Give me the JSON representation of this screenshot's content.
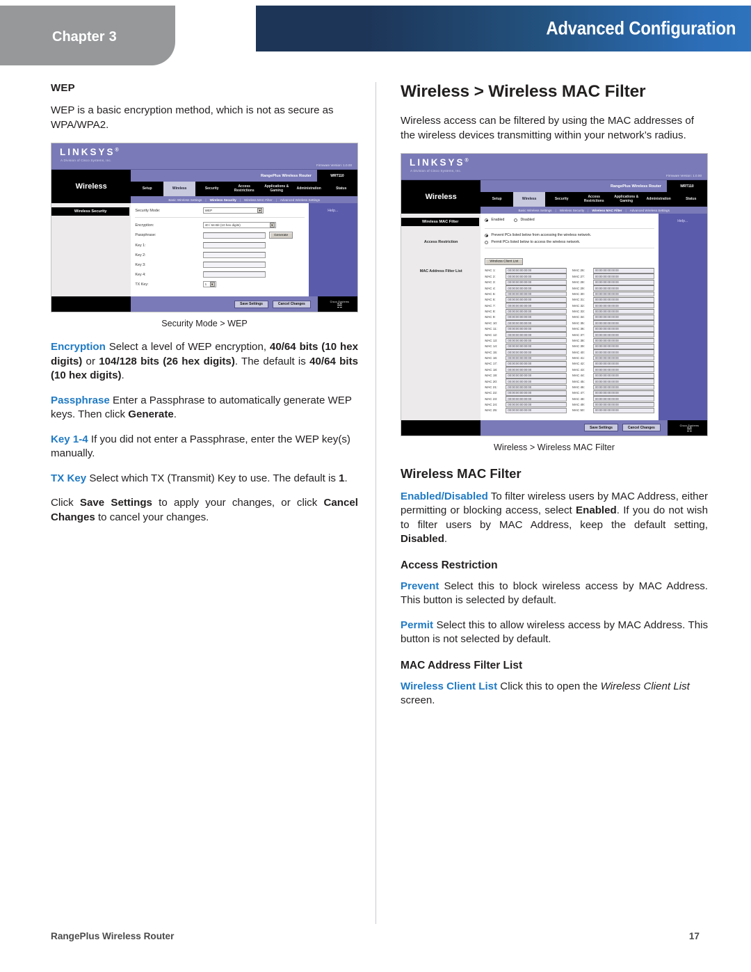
{
  "header": {
    "chapter_label": "Chapter",
    "chapter_number": "3",
    "title": "Advanced Configuration",
    "navy": "#1d3557",
    "blue": "#2b6cb5",
    "gray": "#96989a"
  },
  "accent_color": "#1f7ac4",
  "left_column": {
    "section_heading": "WEP",
    "intro": "WEP is a basic encryption method, which is not as secure as WPA/WPA2.",
    "figure_caption": "Security Mode > WEP",
    "paragraphs": [
      {
        "term": "Encryption",
        "text_parts": [
          {
            "t": " Select a level of WEP encryption, ",
            "style": "normal"
          },
          {
            "t": "40/64 bits (10 hex digits)",
            "style": "bold"
          },
          {
            "t": " or ",
            "style": "normal"
          },
          {
            "t": "104/128 bits (26 hex digits)",
            "style": "bold"
          },
          {
            "t": ". The default is ",
            "style": "normal"
          },
          {
            "t": "40/64 bits (10 hex digits)",
            "style": "bold"
          },
          {
            "t": ".",
            "style": "normal"
          }
        ]
      },
      {
        "term": "Passphrase",
        "text_parts": [
          {
            "t": "  Enter a Passphrase to automatically generate WEP keys. Then click ",
            "style": "normal"
          },
          {
            "t": "Generate",
            "style": "bold"
          },
          {
            "t": ".",
            "style": "normal"
          }
        ]
      },
      {
        "term": "Key 1-4",
        "text_parts": [
          {
            "t": "  If you did not enter a Passphrase, enter the WEP key(s) manually.",
            "style": "normal"
          }
        ]
      },
      {
        "term": "TX Key",
        "text_parts": [
          {
            "t": "  Select which TX (Transmit) Key to use. The default is ",
            "style": "normal"
          },
          {
            "t": "1",
            "style": "bold"
          },
          {
            "t": ".",
            "style": "normal"
          }
        ]
      }
    ],
    "closing_parts": [
      {
        "t": "Click ",
        "style": "normal"
      },
      {
        "t": "Save Settings",
        "style": "bold"
      },
      {
        "t": " to apply your changes, or click ",
        "style": "normal"
      },
      {
        "t": "Cancel Changes",
        "style": "bold"
      },
      {
        "t": " to cancel your changes.",
        "style": "normal"
      }
    ]
  },
  "right_column": {
    "page_heading": "Wireless > Wireless MAC Filter",
    "intro": "Wireless access can be filtered by using the MAC addresses of the wireless devices transmitting within your network’s radius.",
    "figure_caption": "Wireless > Wireless MAC Filter",
    "sub_heading": "Wireless MAC Filter",
    "enabled_disabled": {
      "term": "Enabled/Disabled",
      "parts": [
        {
          "t": "  To filter wireless users by MAC Address, either permitting or blocking access, select ",
          "style": "normal"
        },
        {
          "t": "Enabled",
          "style": "bold"
        },
        {
          "t": ". If you do not wish to filter users by MAC Address, keep the default setting, ",
          "style": "normal"
        },
        {
          "t": "Disabled",
          "style": "bold"
        },
        {
          "t": ".",
          "style": "normal"
        }
      ]
    },
    "access_restriction_heading": "Access Restriction",
    "prevent": {
      "term": "Prevent",
      "parts": [
        {
          "t": " Select this to block wireless access by MAC Address. This button is selected by default.",
          "style": "normal"
        }
      ]
    },
    "permit": {
      "term": "Permit",
      "parts": [
        {
          "t": " Select this to allow wireless access by MAC Address. This button is not selected by default.",
          "style": "normal"
        }
      ]
    },
    "mac_list_heading": "MAC Address Filter List",
    "wireless_client_list": {
      "term": "Wireless Client List",
      "parts": [
        {
          "t": "  Click this to open the ",
          "style": "normal"
        },
        {
          "t": "Wireless Client List",
          "style": "italic"
        },
        {
          "t": " screen.",
          "style": "normal"
        }
      ]
    }
  },
  "router_ui": {
    "brand": "LINKSYS",
    "brand_tm": "®",
    "brand_sub": "A Division of Cisco Systems, Inc.",
    "firmware": "Firmware Version: 1.0.00",
    "model_name": "RangePlus Wireless Router",
    "model_number": "WRT110",
    "section_name": "Wireless",
    "tabs": [
      "Setup",
      "Wireless",
      "Security",
      "Access Restrictions",
      "Applications & Gaming",
      "Administration",
      "Status"
    ],
    "active_tab": "Wireless",
    "subtabs": [
      "Basic Wireless Settings",
      "Wireless Security",
      "Wireless MAC Filter",
      "Advanced Wireless Settings"
    ],
    "help_label": "Help...",
    "save_label": "Save Settings",
    "cancel_label": "Cancel Changes",
    "footer_brand_top": "Cisco Systems",
    "footer_brand_mark": "☵"
  },
  "wep_screen": {
    "panel_title": "Wireless Security",
    "active_subtab": "Wireless Security",
    "fields": [
      {
        "label": "Security Mode:",
        "type": "select",
        "value": "WEP"
      },
      {
        "label": "Encryption:",
        "type": "select",
        "value": "40 / 64-Bit (10 hex digits)"
      },
      {
        "label": "Passphrase:",
        "type": "input",
        "value": "",
        "button": "Generate"
      },
      {
        "label": "Key 1:",
        "type": "input",
        "value": ""
      },
      {
        "label": "Key 2:",
        "type": "input",
        "value": ""
      },
      {
        "label": "Key 3:",
        "type": "input",
        "value": ""
      },
      {
        "label": "Key 4:",
        "type": "input",
        "value": ""
      },
      {
        "label": "TX Key:",
        "type": "smallselect",
        "value": "1"
      }
    ]
  },
  "mac_screen": {
    "panel_title": "Wireless MAC Filter",
    "active_subtab": "Wireless MAC Filter",
    "side_label": "Access Restriction",
    "mac_list_label": "MAC Address Filter List",
    "enable_options": [
      {
        "label": "Enabled",
        "selected": true
      },
      {
        "label": "Disabled",
        "selected": false
      }
    ],
    "restriction_options": [
      {
        "label": "Prevent  PCs listed below from accessing the wireless network.",
        "selected": true
      },
      {
        "label": "Permit  PCs listed below to access the wireless network.",
        "selected": false
      }
    ],
    "client_list_button": "Wireless Client List",
    "mac_placeholder": "00:00:00:00:00:00",
    "mac_count": 50
  },
  "footer": {
    "product": "RangePlus Wireless Router",
    "page_number": "17"
  }
}
